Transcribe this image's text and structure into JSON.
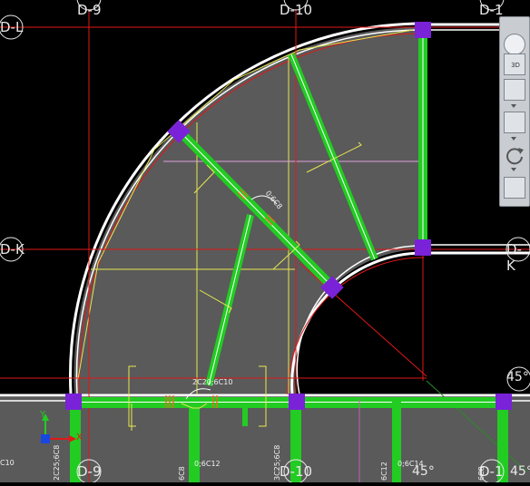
{
  "axis_labels": {
    "d9_top": "D-9",
    "d10_top": "D-10",
    "d11_top": "D-1",
    "dl": "D-L",
    "dk_left": "D-K",
    "dk_right": "D-K",
    "d9_bottom": "D-9",
    "d10_bottom": "D-10",
    "d11_bottom": "D-1"
  },
  "annotations": {
    "beam_diag_1": "0;6C8",
    "beam_bottom": "2C20;6C10",
    "c10_left": "C10",
    "rebar_2c25": "2C25;6C8",
    "rebar_6c8": "6C8",
    "rebar_6c12_1": "0;6C12",
    "rebar_3c25": "3C25;6C8",
    "rebar_6c12_2": "6C12",
    "rebar_6c14": "0;6C14",
    "rebar_6c8_2": "6C8"
  },
  "angles": {
    "right_45": "45°",
    "bottom_45_a": "45°",
    "bottom_45_b": "45°"
  },
  "ucs": {
    "y": "Y",
    "x": "X"
  },
  "viewcube": {
    "caption_3d": "3D",
    "icons": [
      "sphere-icon",
      "cube-3d-icon",
      "box-front-icon",
      "box-iso-icon",
      "orbit-icon",
      "layers-icon"
    ]
  },
  "colors": {
    "background": "#000000",
    "slab": "#5a5a5a",
    "beam": "#22cc22",
    "grid_line": "#e01818",
    "outline": "#ffffff",
    "column": "#7a22d8",
    "annotation": "#e8e850",
    "axis_text": "#e8e8e8"
  }
}
